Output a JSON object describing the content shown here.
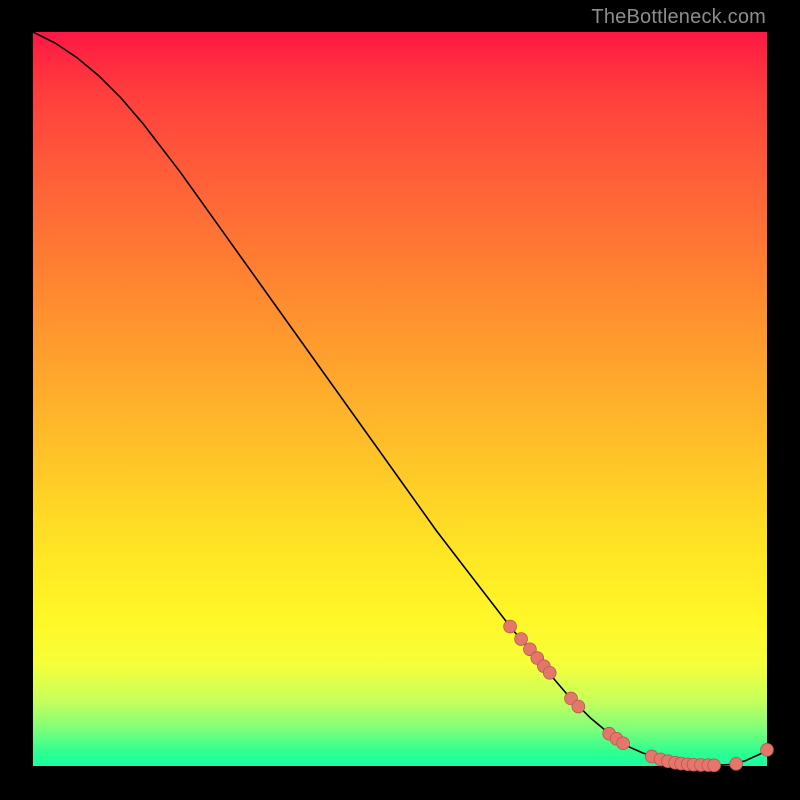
{
  "watermark": "TheBottleneck.com",
  "colors": {
    "curve": "#000000",
    "marker_fill": "#e5766c",
    "marker_stroke": "#b35a52",
    "bg_black": "#000000"
  },
  "chart_data": {
    "type": "line",
    "title": "",
    "xlabel": "",
    "ylabel": "",
    "xlim": [
      0,
      100
    ],
    "ylim": [
      0,
      100
    ],
    "curve": {
      "x": [
        0,
        3,
        6,
        9,
        12,
        15,
        20,
        25,
        30,
        35,
        40,
        45,
        50,
        55,
        60,
        65,
        70,
        73,
        76,
        79,
        81,
        83,
        85,
        87,
        89,
        91,
        93,
        95,
        97,
        99,
        100
      ],
      "y": [
        100,
        98.5,
        96.5,
        94,
        91,
        87.5,
        81,
        74,
        67,
        60,
        53,
        46,
        39,
        32,
        25.5,
        19,
        13,
        9.5,
        6.5,
        4,
        2.7,
        1.8,
        1.1,
        0.6,
        0.3,
        0.15,
        0.1,
        0.2,
        0.7,
        1.6,
        2.2
      ]
    },
    "markers": [
      {
        "x": 65.0,
        "y": 19.0
      },
      {
        "x": 66.5,
        "y": 17.3
      },
      {
        "x": 67.7,
        "y": 15.9
      },
      {
        "x": 68.7,
        "y": 14.7
      },
      {
        "x": 69.6,
        "y": 13.6
      },
      {
        "x": 70.4,
        "y": 12.7
      },
      {
        "x": 73.3,
        "y": 9.2
      },
      {
        "x": 74.3,
        "y": 8.1
      },
      {
        "x": 78.5,
        "y": 4.4
      },
      {
        "x": 79.5,
        "y": 3.7
      },
      {
        "x": 80.4,
        "y": 3.1
      },
      {
        "x": 84.3,
        "y": 1.3
      },
      {
        "x": 85.5,
        "y": 0.9
      },
      {
        "x": 86.5,
        "y": 0.65
      },
      {
        "x": 87.5,
        "y": 0.45
      },
      {
        "x": 88.3,
        "y": 0.33
      },
      {
        "x": 89.2,
        "y": 0.24
      },
      {
        "x": 90.0,
        "y": 0.18
      },
      {
        "x": 91.0,
        "y": 0.15
      },
      {
        "x": 92.0,
        "y": 0.12
      },
      {
        "x": 92.8,
        "y": 0.1
      },
      {
        "x": 95.8,
        "y": 0.3
      },
      {
        "x": 100.0,
        "y": 2.2
      }
    ]
  }
}
